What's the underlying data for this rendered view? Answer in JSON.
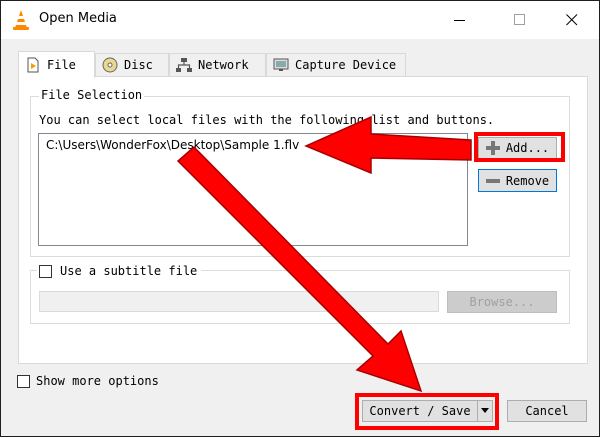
{
  "window": {
    "title": "Open Media",
    "colors": {
      "accent": "#0078d7",
      "annotation": "#ff0000"
    }
  },
  "tabs": [
    {
      "label": "File",
      "icon": "file-play-icon",
      "active": true
    },
    {
      "label": "Disc",
      "icon": "disc-icon",
      "active": false
    },
    {
      "label": "Network",
      "icon": "network-icon",
      "active": false
    },
    {
      "label": "Capture Device",
      "icon": "capture-device-icon",
      "active": false
    }
  ],
  "file_selection": {
    "group_title": "File Selection",
    "instructions": "You can select local files with the following list and buttons.",
    "files": [
      "C:\\Users\\WonderFox\\Desktop\\Sample 1.flv"
    ],
    "add_label": "Add...",
    "remove_label": "Remove"
  },
  "subtitle": {
    "checkbox_label": "Use a subtitle file",
    "checked": false,
    "path_value": "",
    "browse_label": "Browse..."
  },
  "footer": {
    "show_more_label": "Show more options",
    "show_more_checked": false,
    "convert_label": "Convert / Save",
    "cancel_label": "Cancel"
  }
}
